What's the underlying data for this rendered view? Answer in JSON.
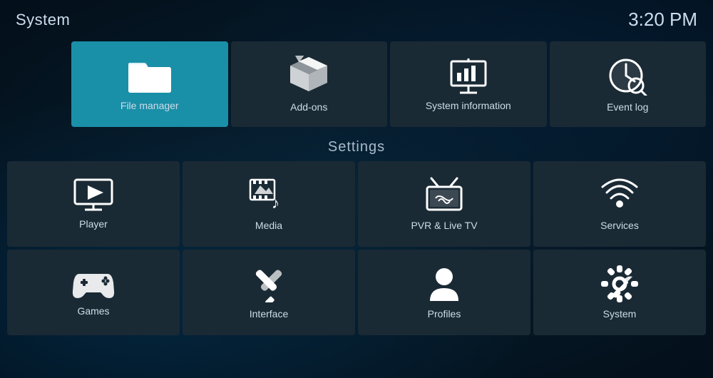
{
  "header": {
    "title": "System",
    "clock": "3:20 PM"
  },
  "top_row": [
    {
      "id": "file-manager",
      "label": "File manager",
      "active": true
    },
    {
      "id": "add-ons",
      "label": "Add-ons",
      "active": false
    },
    {
      "id": "system-information",
      "label": "System information",
      "active": false
    },
    {
      "id": "event-log",
      "label": "Event log",
      "active": false
    }
  ],
  "settings": {
    "section_label": "Settings",
    "items": [
      {
        "id": "player",
        "label": "Player"
      },
      {
        "id": "media",
        "label": "Media"
      },
      {
        "id": "pvr-live-tv",
        "label": "PVR & Live TV"
      },
      {
        "id": "services",
        "label": "Services"
      },
      {
        "id": "games",
        "label": "Games"
      },
      {
        "id": "interface",
        "label": "Interface"
      },
      {
        "id": "profiles",
        "label": "Profiles"
      },
      {
        "id": "system",
        "label": "System"
      }
    ]
  }
}
